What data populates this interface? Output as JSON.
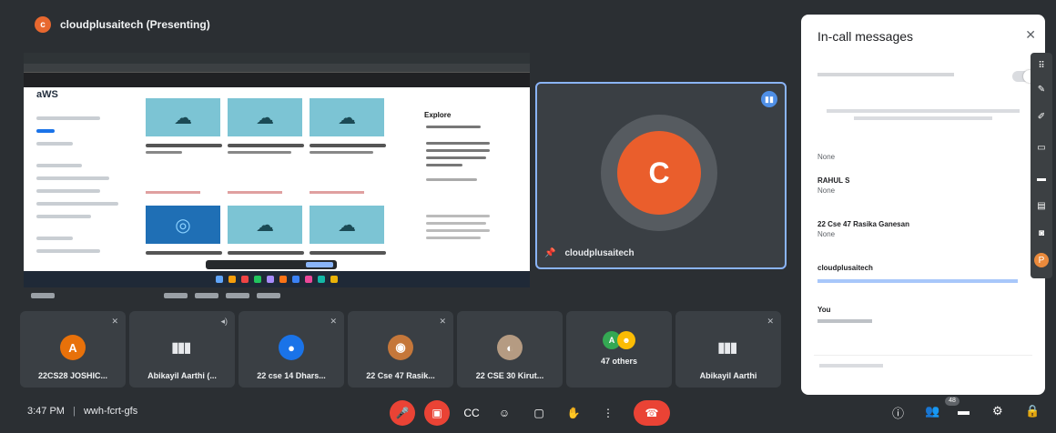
{
  "presenter": {
    "avatar_letter": "c",
    "title": "cloudplusaitech (Presenting)"
  },
  "shared_screen": {
    "logo": "aWS",
    "explore_heading": "Explore"
  },
  "self_tile": {
    "avatar_letter": "C",
    "name": "cloudplusaitech"
  },
  "participants": [
    {
      "name": "22CS28 JOSHIC...",
      "avatar": "A",
      "avatar_color": "#e8710a"
    },
    {
      "name": "Abikayil Aarthi (...",
      "avatar": "",
      "avatar_color": ""
    },
    {
      "name": "22 cse 14 Dhars...",
      "avatar": "person-icon",
      "avatar_color": "#1a73e8"
    },
    {
      "name": "22 Cse 47 Rasik...",
      "avatar": "",
      "avatar_color": "#c5773a"
    },
    {
      "name": "22 CSE 30 Kirut...",
      "avatar": "",
      "avatar_color": "#b59b82"
    },
    {
      "name": "47 others",
      "avatar": "A",
      "avatar_color": "#34a853"
    },
    {
      "name": "Abikayil Aarthi",
      "avatar": "",
      "avatar_color": ""
    }
  ],
  "chat": {
    "title": "In-call messages",
    "messages": [
      {
        "sender": "",
        "text": "None"
      },
      {
        "sender": "RAHUL S",
        "text": "None"
      },
      {
        "sender": "22 Cse 47 Rasika Ganesan",
        "text": "None"
      },
      {
        "sender": "cloudplusaitech",
        "text": ""
      },
      {
        "sender": "You",
        "text": ""
      }
    ]
  },
  "bottom_bar": {
    "time": "3:47 PM",
    "meeting_code": "wwh-fcrt-gfs",
    "participant_count": "48"
  },
  "colors": {
    "accent": "#8ab4f8",
    "danger": "#ea4335",
    "presenter": "#ea5e2c"
  }
}
